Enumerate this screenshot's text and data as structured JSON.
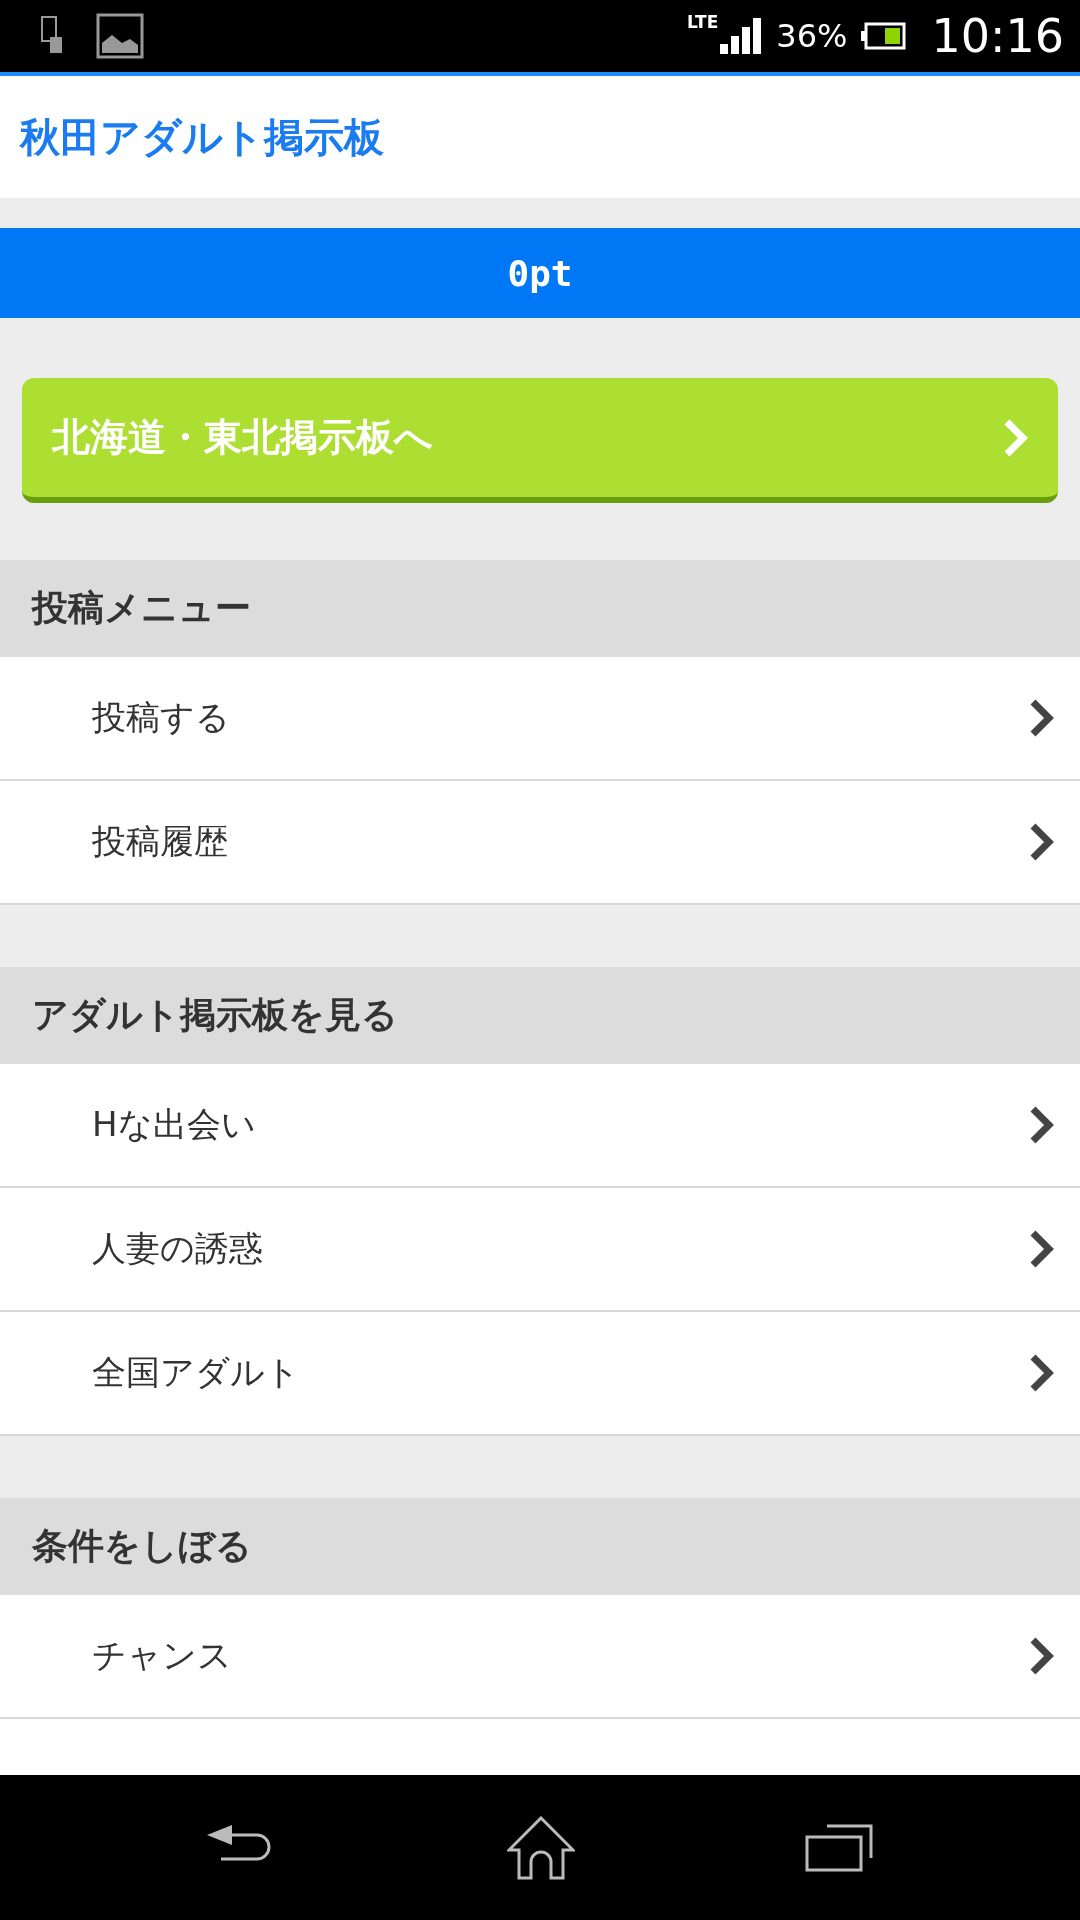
{
  "status_bar": {
    "network": "LTE",
    "battery": "36%",
    "time": "10:16"
  },
  "header": {
    "title": "秋田アダルト掲示板"
  },
  "points": "0pt",
  "region_button": {
    "label": "北海道・東北掲示板へ"
  },
  "sections": [
    {
      "title": "投稿メニュー",
      "items": [
        {
          "kind": "link",
          "label": "投稿する"
        },
        {
          "kind": "link",
          "label": "投稿履歴"
        }
      ]
    },
    {
      "title": "アダルト掲示板を見る",
      "items": [
        {
          "kind": "link",
          "label": "Hな出会い"
        },
        {
          "kind": "link",
          "label": "人妻の誘惑"
        },
        {
          "kind": "link",
          "label": "全国アダルト"
        }
      ]
    },
    {
      "title": "条件をしぼる",
      "items": [
        {
          "kind": "link",
          "label": "チャンス"
        },
        {
          "kind": "partial"
        }
      ]
    }
  ]
}
